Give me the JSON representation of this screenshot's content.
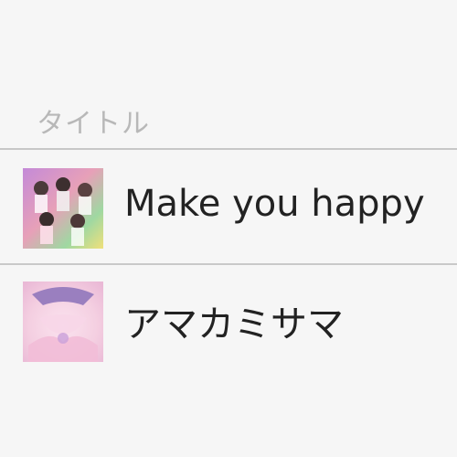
{
  "list": {
    "header": {
      "title_column": "タイトル"
    },
    "tracks": [
      {
        "title": "Make you happy",
        "artwork_icon": "album-art-icon"
      },
      {
        "title": "アマカミサマ",
        "artwork_icon": "album-art-icon"
      }
    ]
  },
  "colors": {
    "background": "#f6f6f6",
    "header_text": "#b8b8b8",
    "row_text": "#222222",
    "divider": "#c7c7c7"
  }
}
